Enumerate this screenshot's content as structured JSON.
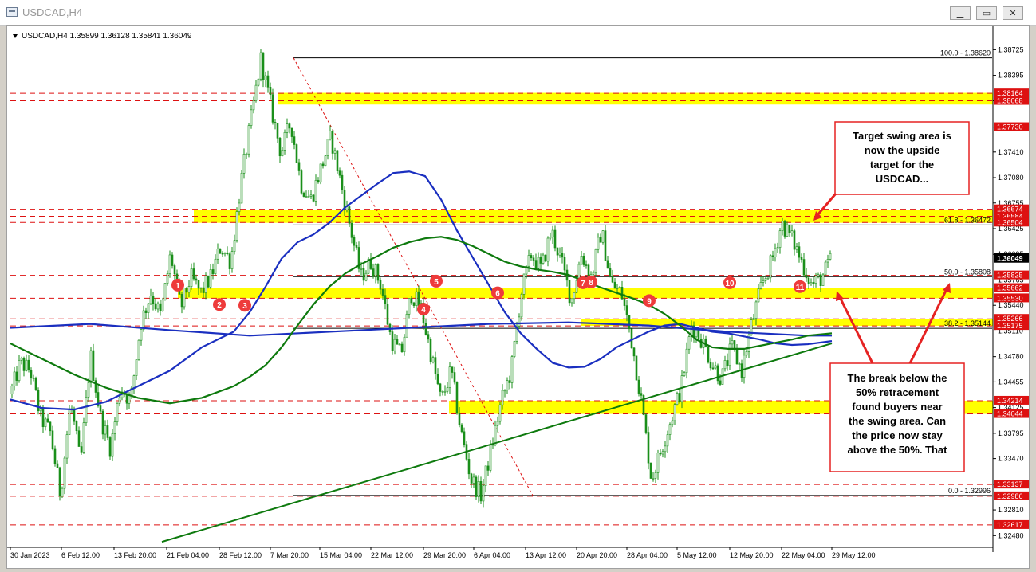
{
  "window": {
    "title": "USDCAD,H4",
    "buttons": [
      "minimize",
      "maximize",
      "close"
    ]
  },
  "chart_data": {
    "type": "line",
    "title": "USDCAD,H4",
    "ohlc_label": "USDCAD,H4  1.35899 1.36128 1.35841 1.36049",
    "symbol": "USDCAD",
    "timeframe": "H4",
    "open": 1.35899,
    "high": 1.36128,
    "low": 1.35841,
    "close": 1.36049,
    "current_price_label": "1.36049",
    "y_range": [
      1.3235,
      1.3878
    ],
    "x_range": [
      0,
      1229
    ],
    "y_ticks": [
      "1.38725",
      "1.38395",
      "1.38068",
      "1.37730",
      "1.37410",
      "1.37080",
      "1.36755",
      "1.36425",
      "1.36095",
      "1.35765",
      "1.35440",
      "1.35110",
      "1.34780",
      "1.34455",
      "1.34125",
      "1.33795",
      "1.33470",
      "1.33140",
      "1.32810",
      "1.32480"
    ],
    "x_tick_labels": [
      "30 Jan 2023",
      "6 Feb 12:00",
      "13 Feb 20:00",
      "21 Feb 04:00",
      "28 Feb 12:00",
      "7 Mar 20:00",
      "15 Mar 04:00",
      "22 Mar 12:00",
      "29 Mar 20:00",
      "6 Apr 04:00",
      "13 Apr 12:00",
      "20 Apr 20:00",
      "28 Apr 04:00",
      "5 May 12:00",
      "12 May 20:00",
      "22 May 04:00",
      "29 May 12:00"
    ],
    "x_tick_pos": [
      0,
      64,
      130,
      196,
      262,
      326,
      388,
      452,
      518,
      581,
      646,
      710,
      773,
      836,
      902,
      967,
      1030
    ],
    "price_labels": [
      {
        "text": "1.38164",
        "value": 1.38164,
        "color": "#dd1111"
      },
      {
        "text": "1.38068",
        "value": 1.38068,
        "color": "#dd1111"
      },
      {
        "text": "1.37730",
        "value": 1.3773,
        "color": "#dd1111"
      },
      {
        "text": "1.36674",
        "value": 1.36674,
        "color": "#dd1111"
      },
      {
        "text": "1.36584",
        "value": 1.36584,
        "color": "#dd1111"
      },
      {
        "text": "1.36504",
        "value": 1.36504,
        "color": "#dd1111"
      },
      {
        "text": "1.35825",
        "value": 1.35825,
        "color": "#dd1111"
      },
      {
        "text": "1.35662",
        "value": 1.35662,
        "color": "#dd1111"
      },
      {
        "text": "1.35530",
        "value": 1.3553,
        "color": "#dd1111"
      },
      {
        "text": "1.35266",
        "value": 1.35266,
        "color": "#dd1111"
      },
      {
        "text": "1.35175",
        "value": 1.35175,
        "color": "#dd1111"
      },
      {
        "text": "1.34214",
        "value": 1.34214,
        "color": "#dd1111"
      },
      {
        "text": "1.34044",
        "value": 1.34044,
        "color": "#dd1111"
      },
      {
        "text": "1.33137",
        "value": 1.33137,
        "color": "#dd1111"
      },
      {
        "text": "1.32986",
        "value": 1.32986,
        "color": "#dd1111"
      },
      {
        "text": "1.32617",
        "value": 1.32617,
        "color": "#dd1111"
      }
    ],
    "fib_levels": [
      {
        "label": "100.0 - 1.38620",
        "value": 1.3862
      },
      {
        "label": "61.8 - 1.36472",
        "value": 1.36472
      },
      {
        "label": "50.0 - 1.35808",
        "value": 1.35808
      },
      {
        "label": "38.2 - 1.35144",
        "value": 1.35144
      },
      {
        "label": "0.0 - 1.32996",
        "value": 1.32996
      }
    ],
    "hlines_red": [
      1.38164,
      1.38068,
      1.3773,
      1.36674,
      1.36584,
      1.36504,
      1.35825,
      1.35662,
      1.3553,
      1.35266,
      1.35175,
      1.34214,
      1.34044,
      1.33137,
      1.32986,
      1.32617
    ],
    "zones": [
      {
        "x0": 335,
        "x1": 1235,
        "y0": 1.3817,
        "y1": 1.3802
      },
      {
        "x0": 230,
        "x1": 1235,
        "y0": 1.3667,
        "y1": 1.365
      },
      {
        "x0": 210,
        "x1": 1235,
        "y0": 1.35662,
        "y1": 1.3553
      },
      {
        "x0": 715,
        "x1": 1235,
        "y0": 1.35266,
        "y1": 1.35175
      },
      {
        "x0": 550,
        "x1": 1235,
        "y0": 1.34214,
        "y1": 1.34044
      }
    ],
    "series": [
      {
        "name": "",
        "color": "#1a2fc0",
        "x": [
          0,
          40,
          80,
          120,
          160,
          200,
          240,
          280,
          300,
          320,
          340,
          360,
          380,
          400,
          420,
          440,
          460,
          480,
          500,
          520,
          540,
          560,
          580,
          600,
          620,
          640,
          660,
          680,
          700,
          720,
          740,
          760,
          780,
          800,
          820,
          840,
          860,
          880,
          900,
          920,
          940,
          960,
          980,
          1000,
          1030
        ],
        "y": [
          1.3423,
          1.3412,
          1.341,
          1.342,
          1.344,
          1.346,
          1.349,
          1.351,
          1.3535,
          1.3568,
          1.3604,
          1.3625,
          1.3635,
          1.365,
          1.367,
          1.3685,
          1.37,
          1.3714,
          1.3716,
          1.371,
          1.368,
          1.364,
          1.3605,
          1.357,
          1.3535,
          1.3508,
          1.3488,
          1.347,
          1.3464,
          1.3465,
          1.3475,
          1.349,
          1.35,
          1.351,
          1.3518,
          1.352,
          1.3515,
          1.351,
          1.3508,
          1.3504,
          1.35,
          1.3495,
          1.3493,
          1.3494,
          1.3498
        ]
      },
      {
        "name": "",
        "color": "#1a2fc0",
        "x": [
          0,
          100,
          200,
          300,
          400,
          500,
          600,
          700,
          800,
          900,
          1000,
          1030
        ],
        "y": [
          1.3515,
          1.352,
          1.3512,
          1.3505,
          1.351,
          1.3515,
          1.352,
          1.3522,
          1.3518,
          1.351,
          1.3505,
          1.3505
        ]
      },
      {
        "name": "",
        "color": "#0e7a0e",
        "x": [
          0,
          40,
          80,
          120,
          160,
          200,
          240,
          280,
          300,
          320,
          340,
          360,
          380,
          400,
          420,
          440,
          460,
          480,
          500,
          520,
          540,
          560,
          580,
          600,
          620,
          640,
          660,
          680,
          700,
          720,
          740,
          760,
          780,
          800,
          820,
          840,
          860,
          880,
          900,
          920,
          940,
          960,
          980,
          1000,
          1030
        ],
        "y": [
          1.3495,
          1.3475,
          1.3455,
          1.3438,
          1.3425,
          1.3418,
          1.3425,
          1.344,
          1.3452,
          1.3467,
          1.349,
          1.3518,
          1.3545,
          1.3568,
          1.3585,
          1.3597,
          1.3607,
          1.3618,
          1.3625,
          1.363,
          1.3632,
          1.3628,
          1.362,
          1.361,
          1.36,
          1.3594,
          1.359,
          1.3587,
          1.3583,
          1.3575,
          1.3567,
          1.356,
          1.3553,
          1.3545,
          1.3533,
          1.3518,
          1.35,
          1.349,
          1.3488,
          1.3488,
          1.3492,
          1.3496,
          1.35,
          1.3505,
          1.3508
        ]
      },
      {
        "name": "",
        "color": "#0e7a0e",
        "x": [
          190,
          1030
        ],
        "y": [
          1.324,
          1.3495
        ]
      }
    ],
    "candles_seed": [
      1.343,
      1.347,
      1.346,
      1.34,
      1.338,
      1.33,
      1.342,
      1.334,
      1.348,
      1.34,
      1.336,
      1.344,
      1.342,
      1.352,
      1.356,
      1.353,
      1.361,
      1.354,
      1.358,
      1.356,
      1.358,
      1.362,
      1.36,
      1.37,
      1.378,
      1.386,
      1.38,
      1.374,
      1.378,
      1.37,
      1.368,
      1.372,
      1.376,
      1.37,
      1.364,
      1.358,
      1.36,
      1.357,
      1.35,
      1.348,
      1.356,
      1.354,
      1.348,
      1.342,
      1.346,
      1.338,
      1.332,
      1.33,
      1.336,
      1.342,
      1.346,
      1.356,
      1.361,
      1.359,
      1.364,
      1.36,
      1.355,
      1.361,
      1.358,
      1.364,
      1.357,
      1.356,
      1.35,
      1.342,
      1.332,
      1.336,
      1.34,
      1.344,
      1.352,
      1.35,
      1.347,
      1.345,
      1.349,
      1.346,
      1.352,
      1.357,
      1.36,
      1.365,
      1.363,
      1.36,
      1.357,
      1.358,
      1.3604
    ],
    "swing_markers": [
      {
        "label": "1",
        "x": 210,
        "y": 1.357
      },
      {
        "label": "2",
        "x": 262,
        "y": 1.3545
      },
      {
        "label": "3",
        "x": 294,
        "y": 1.3544
      },
      {
        "label": "4",
        "x": 518,
        "y": 1.3539
      },
      {
        "label": "5",
        "x": 534,
        "y": 1.3575
      },
      {
        "label": "6",
        "x": 611,
        "y": 1.356
      },
      {
        "label": "7",
        "x": 718,
        "y": 1.3573
      },
      {
        "label": "8",
        "x": 728,
        "y": 1.3574
      },
      {
        "label": "9",
        "x": 801,
        "y": 1.355
      },
      {
        "label": "10",
        "x": 902,
        "y": 1.3573
      },
      {
        "label": "11",
        "x": 990,
        "y": 1.3568
      }
    ],
    "annotations": [
      "Target swing area is now the upside target for the USDCAD...",
      "The break below the 50% retracement found buyers near the swing area.  Can the price now stay above the 50%. That"
    ]
  },
  "annotation_top": {
    "lines": [
      "Target swing area is",
      "now the upside",
      "target for the",
      "USDCAD..."
    ]
  },
  "annotation_bottom": {
    "lines": [
      "The break below the",
      "50% retracement",
      "found buyers near",
      "the swing area.  Can",
      "the price now stay",
      "above the 50%. That"
    ]
  }
}
